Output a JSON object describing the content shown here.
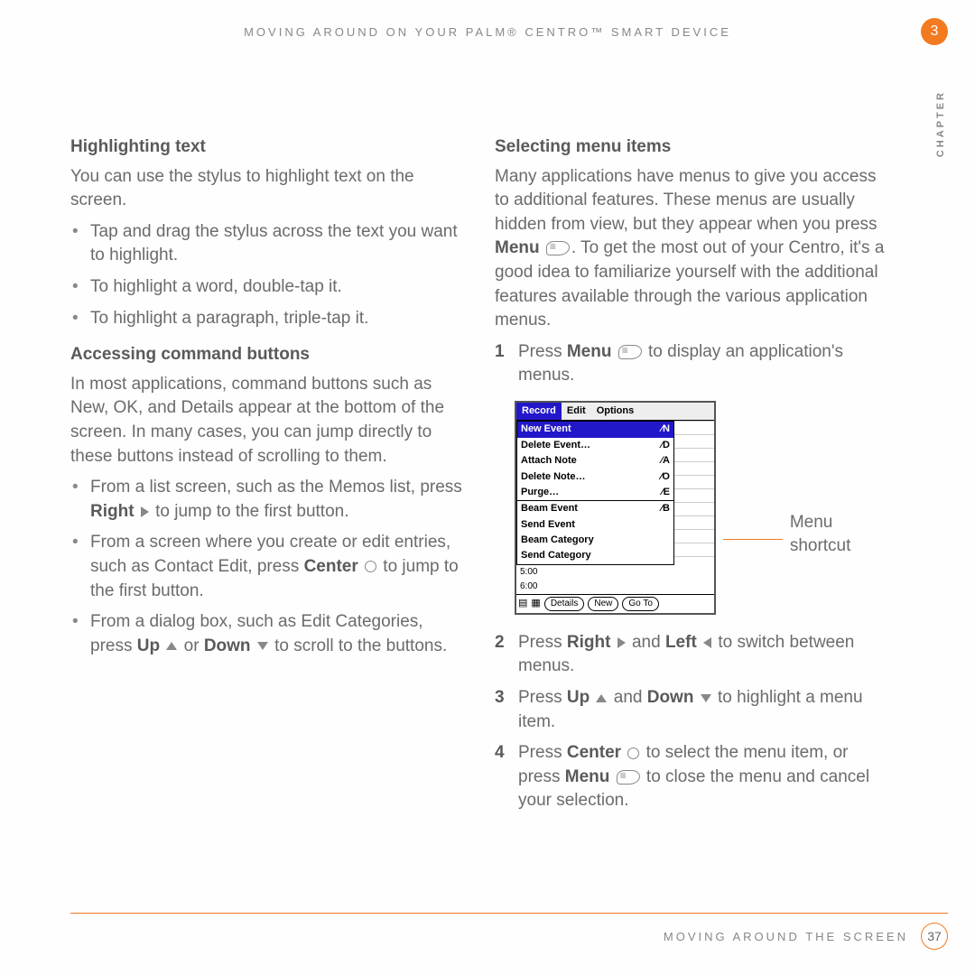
{
  "header": {
    "running_title": "MOVING AROUND ON YOUR PALM® CENTRO™ SMART DEVICE",
    "chapter_number": "3",
    "chapter_label": "CHAPTER"
  },
  "left": {
    "h1": "Highlighting text",
    "p1": "You can use the stylus to highlight text on the screen.",
    "bullets1": [
      "Tap and drag the stylus across the text you want to highlight.",
      "To highlight a word, double-tap it.",
      "To highlight a paragraph, triple-tap it."
    ],
    "h2": "Accessing command buttons",
    "p2": "In most applications, command buttons such as New, OK, and Details appear at the bottom of the screen. In many cases, you can jump directly to these buttons instead of scrolling to them.",
    "b2a_pre": "From a list screen, such as the Memos list, press ",
    "b2a_key": "Right",
    "b2a_post": " to jump to the first button.",
    "b2b_pre": "From a screen where you create or edit entries, such as Contact Edit, press ",
    "b2b_key": "Center",
    "b2b_post": " to jump to the first button.",
    "b2c_pre": "From a dialog box, such as Edit Categories, press ",
    "b2c_k1": "Up",
    "b2c_mid": " or ",
    "b2c_k2": "Down",
    "b2c_post": " to scroll to the buttons."
  },
  "right": {
    "h1": "Selecting menu items",
    "p1_pre": "Many applications have menus to give you access to additional features. These menus are usually hidden from view, but they appear when you press ",
    "p1_key": "Menu",
    "p1_post": ". To get the most out of your Centro, it's a good idea to familiarize yourself with the additional features available through the various application menus.",
    "s1_pre": "Press ",
    "s1_key": "Menu",
    "s1_post": " to display an application's menus.",
    "s2_pre": "Press ",
    "s2_k1": "Right",
    "s2_mid": " and ",
    "s2_k2": "Left",
    "s2_post": " to switch between menus.",
    "s3_pre": "Press ",
    "s3_k1": "Up",
    "s3_mid": " and ",
    "s3_k2": "Down",
    "s3_post": " to highlight a menu item.",
    "s4_pre": "Press ",
    "s4_k1": "Center",
    "s4_mid": " to select the menu item, or press ",
    "s4_k2": "Menu",
    "s4_post": " to close the menu and cancel your selection.",
    "step1": "1",
    "step2": "2",
    "step3": "3",
    "step4": "4",
    "callout": "Menu shortcut"
  },
  "device": {
    "menubar": [
      "Record",
      "Edit",
      "Options"
    ],
    "group1": [
      {
        "label": "New Event",
        "sc": "⁄N",
        "sel": true
      },
      {
        "label": "Delete Event…",
        "sc": "⁄D"
      },
      {
        "label": "Attach Note",
        "sc": "⁄A"
      },
      {
        "label": "Delete Note…",
        "sc": "⁄O"
      },
      {
        "label": "Purge…",
        "sc": "⁄E"
      }
    ],
    "group2": [
      {
        "label": "Beam Event",
        "sc": "⁄B"
      },
      {
        "label": "Send Event"
      },
      {
        "label": "Beam Category"
      },
      {
        "label": "Send Category"
      }
    ],
    "times": [
      "5:00",
      "6:00"
    ],
    "buttons": [
      "Details",
      "New",
      "Go To"
    ]
  },
  "footer": {
    "section": "MOVING AROUND THE SCREEN",
    "page": "37"
  }
}
